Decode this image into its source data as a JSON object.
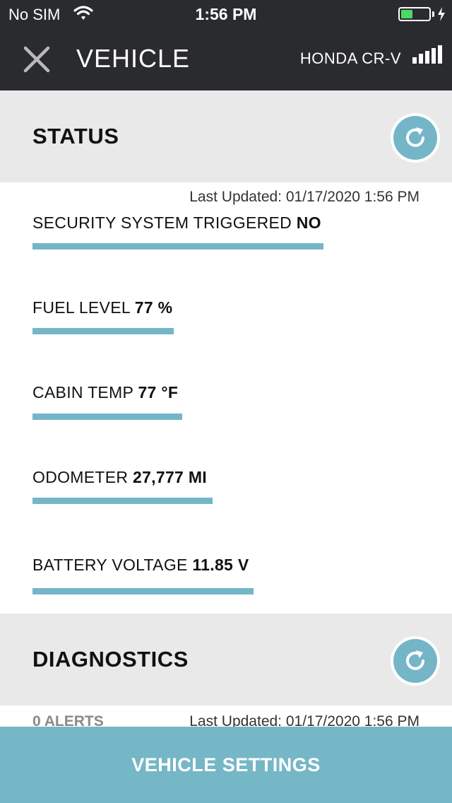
{
  "status_bar": {
    "carrier": "No SIM",
    "time": "1:56 PM",
    "battery_level": 0.42,
    "battery_color": "#4cd964"
  },
  "nav": {
    "title": "VEHICLE",
    "vehicle_name": "HONDA CR-V",
    "close_icon": "close-icon",
    "signal_icon": "signal-bars-icon"
  },
  "status_section": {
    "title": "STATUS",
    "last_updated": "Last Updated: 01/17/2020 1:56 PM",
    "refresh_icon": "refresh-icon",
    "items": [
      {
        "label": "SECURITY SYSTEM TRIGGERED",
        "value": "NO"
      },
      {
        "label": "FUEL LEVEL",
        "value": "77 %"
      },
      {
        "label": "CABIN TEMP",
        "value": "77 °F"
      },
      {
        "label": "ODOMETER",
        "value": "27,777 MI"
      },
      {
        "label": "BATTERY VOLTAGE",
        "value": "11.85 V"
      }
    ]
  },
  "diagnostics_section": {
    "title": "DIAGNOSTICS",
    "alerts": "0 ALERTS",
    "last_updated": "Last Updated: 01/17/2020 1:56 PM",
    "refresh_icon": "refresh-icon"
  },
  "footer": {
    "button_label": "VEHICLE SETTINGS"
  },
  "colors": {
    "header_bg": "#2a2b2e",
    "section_bg": "#e9e9e9",
    "accent": "#74b6c8"
  }
}
